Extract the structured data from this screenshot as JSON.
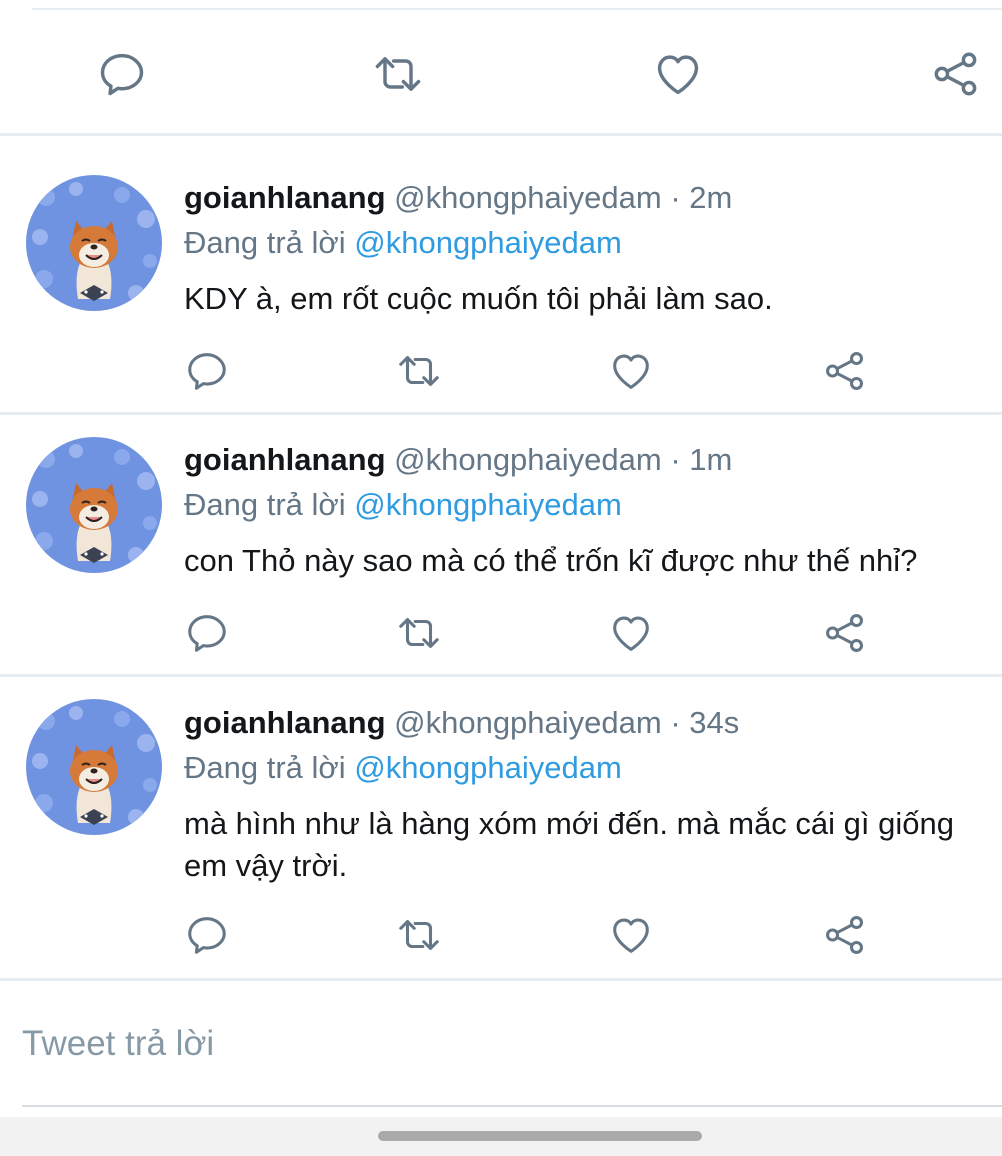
{
  "colors": {
    "icon": "#657786",
    "mention": "#2f9be0",
    "divider": "#e6ecf0",
    "placeholder": "#8899a6"
  },
  "top_actions": {
    "icons": [
      "reply-icon",
      "retweet-icon",
      "like-icon",
      "share-icon"
    ]
  },
  "tweets": [
    {
      "name": "goianhlanang",
      "handle": "@khongphaiyedam",
      "time": "· 2m",
      "reply_prefix": "Đang trả lời",
      "reply_to": "@khongphaiyedam",
      "text": "KDY à, em rốt cuộc muốn tôi phải làm sao."
    },
    {
      "name": "goianhlanang",
      "handle": "@khongphaiyedam",
      "time": "· 1m",
      "reply_prefix": "Đang trả lời",
      "reply_to": "@khongphaiyedam",
      "text": "con Thỏ này sao mà có thể trốn kĩ được như thế nhỉ?"
    },
    {
      "name": "goianhlanang",
      "handle": "@khongphaiyedam",
      "time": "· 34s",
      "reply_prefix": "Đang trả lời",
      "reply_to": "@khongphaiyedam",
      "text": "mà hình như là hàng xóm mới đến. mà mắc cái gì giống em vậy trời."
    }
  ],
  "compose": {
    "placeholder": "Tweet trả lời"
  }
}
